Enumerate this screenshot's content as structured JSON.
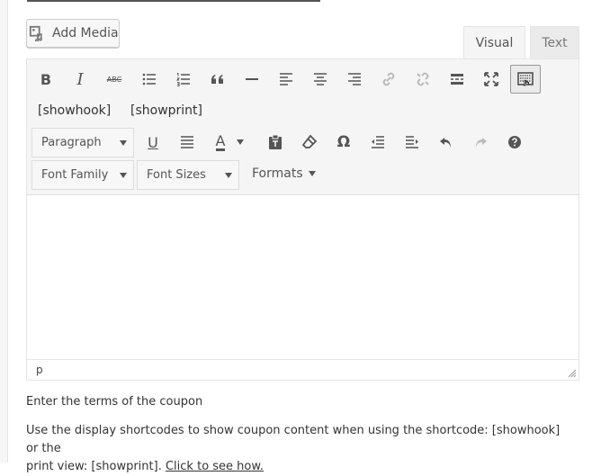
{
  "add_media": {
    "label": "Add Media",
    "icon": "media-icon"
  },
  "tabs": {
    "visual": "Visual",
    "text": "Text",
    "active": "Visual"
  },
  "toolbar": {
    "row1_icons": [
      "bold-icon",
      "italic-icon",
      "strikethrough-icon",
      "bullet-list-icon",
      "numbered-list-icon",
      "blockquote-icon",
      "horizontal-rule-icon",
      "align-left-icon",
      "align-center-icon",
      "align-right-icon",
      "insert-link-icon",
      "remove-link-icon",
      "read-more-icon",
      "fullscreen-icon",
      "toolbar-toggle-icon"
    ],
    "shortcodes": [
      "[showhook]",
      "[showprint]"
    ],
    "paragraph_select": "Paragraph",
    "font_family_select": "Font Family",
    "font_sizes_select": "Font Sizes",
    "formats_menu": "Formats",
    "glyphs": {
      "bold": "B",
      "italic": "I",
      "strikethrough": "ABC",
      "underline": "U",
      "text_color": "A",
      "special_char": "Ω"
    }
  },
  "status": {
    "path": "p"
  },
  "help": {
    "terms": "Enter the terms of the coupon",
    "line1": "Use the display shortcodes to show coupon content when using the shortcode: [showhook] or the",
    "line2": "print view: [showprint].",
    "link": "Click to see how."
  },
  "colors": {
    "toolbar_bg": "#f5f5f5",
    "icon": "#555555",
    "icon_disabled": "#bbbbbb",
    "border": "#e5e5e5"
  }
}
